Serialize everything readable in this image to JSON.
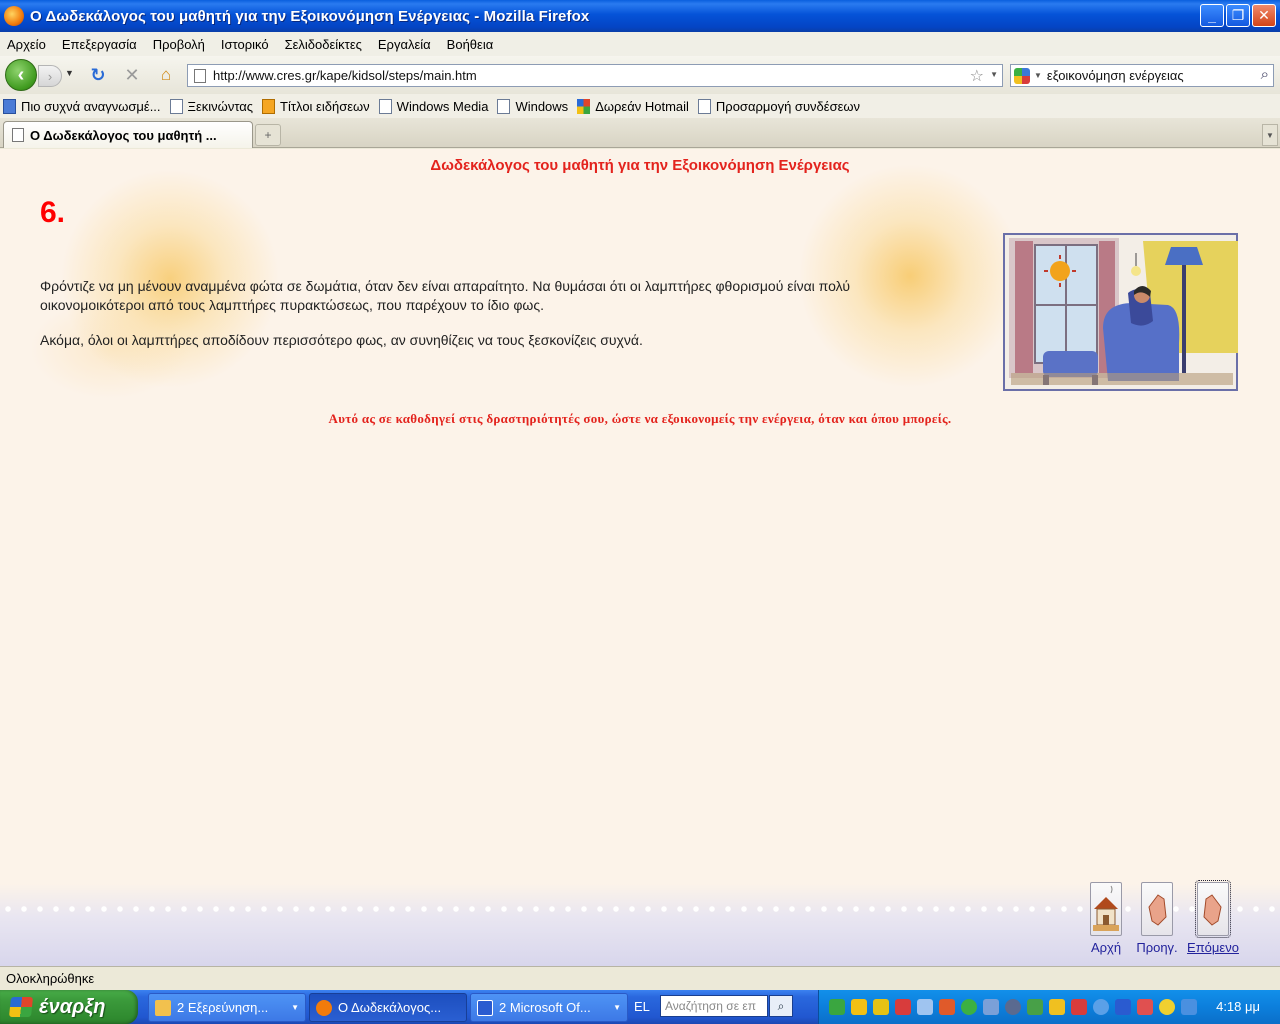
{
  "window": {
    "title": "Ο Δωδεκάλογος του μαθητή για την Εξοικονόμηση Ενέργειας - Mozilla Firefox",
    "minimize": "_",
    "maximize": "❐",
    "close": "✕"
  },
  "menu": [
    "Αρχείο",
    "Επεξεργασία",
    "Προβολή",
    "Ιστορικό",
    "Σελιδοδείκτες",
    "Εργαλεία",
    "Βοήθεια"
  ],
  "nav": {
    "url": "http://www.cres.gr/kape/kidsol/steps/main.htm",
    "search_value": "εξοικονόμηση ενέργειας"
  },
  "bookmarks": [
    {
      "label": "Πιο συχνά αναγνωσμέ...",
      "icon": "blue"
    },
    {
      "label": "Ξεκινώντας",
      "icon": "page"
    },
    {
      "label": "Τίτλοι ειδήσεων",
      "icon": "rss"
    },
    {
      "label": "Windows Media",
      "icon": "page"
    },
    {
      "label": "Windows",
      "icon": "page"
    },
    {
      "label": "Δωρεάν Hotmail",
      "icon": "win"
    },
    {
      "label": "Προσαρμογή συνδέσεων",
      "icon": "page"
    }
  ],
  "tab": {
    "label": "Ο Δωδεκάλογος του μαθητή ...",
    "new_tab": "+"
  },
  "content": {
    "heading": "Δωδεκάλογος του μαθητή για την Εξοικονόμηση Ενέργειας",
    "number": "6.",
    "paragraph1": "Φρόντιζε να μη μένουν αναμμένα φώτα σε δωμάτια, όταν δεν είναι απαραίτητο. Να θυμάσαι ότι οι λαμπτήρες φθορισμού είναι πολύ οικονομοικότεροι από τους λαμπτήρες πυρακτώσεως, που παρέχουν το ίδιο φως.",
    "paragraph2": "Ακόμα, όλοι οι λαμπτήρες αποδίδουν περισσότερο φως, αν συνηθίζεις να τους ξεσκονίζεις συχνά.",
    "note": "Αυτό ας σε καθοδηγεί  στις δραστηριότητές σου, ώστε να εξοικονομείς την ενέργεια, όταν και όπου μπορείς."
  },
  "page_nav": {
    "home": "Αρχή",
    "prev": "Προηγ.",
    "next": "Επόμενο"
  },
  "status": "Ολοκληρώθηκε",
  "taskbar": {
    "start": "έναρξη",
    "items": [
      {
        "label": "2 Εξερεύνηση...",
        "color": "#f2c14e"
      },
      {
        "label": "Ο Δωδεκάλογος...",
        "color": "#f27b0c"
      },
      {
        "label": "2 Microsoft Of...",
        "color": "#2a5bd0"
      }
    ],
    "lang": "EL",
    "search_placeholder": "Αναζήτηση σε επ",
    "clock": "4:18 μμ"
  }
}
